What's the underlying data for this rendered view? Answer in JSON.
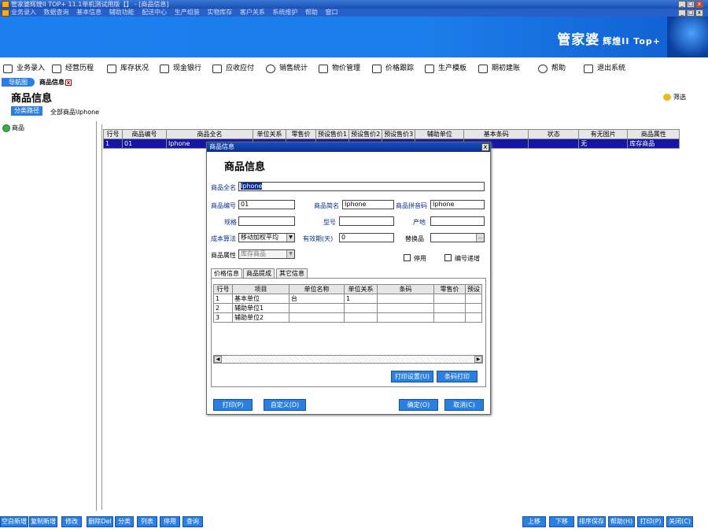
{
  "window": {
    "title": "管家婆辉煌II TOP+ 11.1单机测试用版【】 - [商品信息]",
    "controls": [
      "_",
      "□",
      "x"
    ]
  },
  "menu": [
    "业务录入",
    "数据查询",
    "基本信息",
    "辅助功能",
    "配送中心",
    "生产组装",
    "实物库存",
    "客户关系",
    "系统维护",
    "帮助",
    "窗口"
  ],
  "brand": {
    "name": "管家婆",
    "sub": "辉煌II Top+"
  },
  "toolbar": [
    "业务录入",
    "经营历程",
    "库存状况",
    "现金银行",
    "应收应付",
    "销售统计",
    "物价管理",
    "价格跟踪",
    "生产模板",
    "期初建账",
    "帮助",
    "退出系统"
  ],
  "tabs": {
    "nav": "导航图",
    "current": "商品信息"
  },
  "page": {
    "title": "商品信息",
    "filter": "筛选",
    "path_button": "分类路径",
    "path_value": "全部商品\\Iphone"
  },
  "tree": {
    "root": "商品"
  },
  "grid": {
    "headers": [
      "行号",
      "商品编号",
      "商品全名",
      "单位关系",
      "零售价",
      "预设售价1",
      "预设售价2",
      "预设售价3",
      "辅助单位",
      "基本条码",
      "状态",
      "有无图片",
      "商品属性"
    ],
    "rows": [
      [
        "1",
        "01",
        "Iphone",
        "",
        "",
        "",
        "",
        "",
        "",
        "",
        "",
        "无",
        "库存商品"
      ]
    ]
  },
  "dialog": {
    "title": "商品信息",
    "heading": "商品信息",
    "fields": {
      "full_name_label": "商品全名",
      "full_name": "Iphone",
      "code_label": "商品编号",
      "code": "01",
      "short_name_label": "商品简名",
      "short_name": "Iphone",
      "pinyin_label": "商品拼音码",
      "pinyin": "Iphone",
      "spec_label": "规格",
      "spec": "",
      "model_label": "型号",
      "model": "",
      "origin_label": "产地",
      "origin": "",
      "cost_method_label": "成本算法",
      "cost_method": "移动加权平均",
      "validity_label": "有效期(天)",
      "validity": "0",
      "substitute_label": "替换品",
      "substitute": "",
      "attr_label": "商品属性",
      "attr": "库存商品"
    },
    "checkboxes": {
      "disabled": "停用",
      "auto_code": "编号递增"
    },
    "tabs": [
      "价格信息",
      "商品提成",
      "其它信息"
    ],
    "price_table": {
      "headers": [
        "行号",
        "项目",
        "单位名称",
        "单位关系",
        "条码",
        "零售价",
        "预设"
      ],
      "rows": [
        [
          "1",
          "基本单位",
          "台",
          "1",
          "",
          "",
          ""
        ],
        [
          "2",
          "辅助单位1",
          "",
          "",
          "",
          "",
          ""
        ],
        [
          "3",
          "辅助单位2",
          "",
          "",
          "",
          "",
          ""
        ]
      ]
    },
    "buttons": {
      "print_settings": "打印设置(U)",
      "barcode_print": "条码打印",
      "print": "打印(P)",
      "custom": "自定义(D)",
      "ok": "确定(O)",
      "cancel": "取消(C)"
    }
  },
  "footer": {
    "left": [
      "空白新增",
      "复制新增",
      "修改",
      "删除Del",
      "分类",
      "列表",
      "停用",
      "查询"
    ],
    "right": [
      "上移",
      "下移",
      "排序保存",
      "帮助(H)",
      "打印(P)",
      "关闭(C)"
    ]
  },
  "colors": {
    "accent": "#2a7fe0",
    "selection": "#1515a8",
    "titlebar": "#0a2e90"
  }
}
